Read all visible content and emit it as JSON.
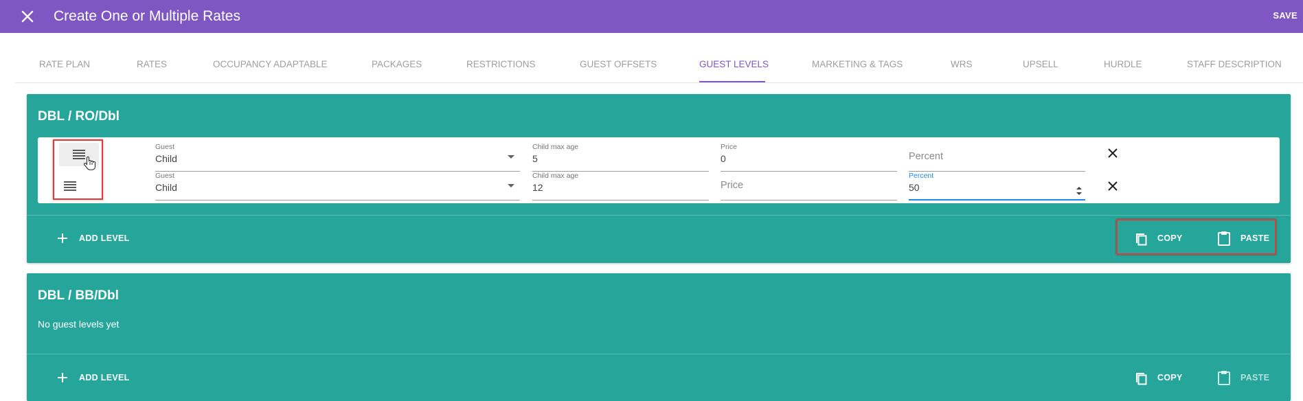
{
  "header": {
    "title": "Create One or Multiple Rates",
    "save_label": "SAVE",
    "close_icon": "close-icon"
  },
  "tabs": [
    {
      "label": "RATE PLAN"
    },
    {
      "label": "RATES"
    },
    {
      "label": "OCCUPANCY ADAPTABLE"
    },
    {
      "label": "PACKAGES"
    },
    {
      "label": "RESTRICTIONS"
    },
    {
      "label": "GUEST OFFSETS"
    },
    {
      "label": "GUEST LEVELS",
      "active": true
    },
    {
      "label": "MARKETING & TAGS"
    },
    {
      "label": "WRS"
    },
    {
      "label": "UPSELL"
    },
    {
      "label": "HURDLE"
    },
    {
      "label": "STAFF DESCRIPTION"
    }
  ],
  "colors": {
    "header": "#7e57c2",
    "card": "#26a69a",
    "focus": "#1e88e5",
    "highlight": "#e53935"
  },
  "cards": [
    {
      "title": "DBL / RO/Dbl",
      "levels": [
        {
          "guest": {
            "label": "Guest",
            "value": "Child"
          },
          "child_max_age": {
            "label": "Child max age",
            "value": "5"
          },
          "price": {
            "label": "Price",
            "value": "0"
          },
          "percent": {
            "placeholder": "Percent"
          }
        },
        {
          "guest": {
            "label": "Guest",
            "value": "Child"
          },
          "child_max_age": {
            "label": "Child max age",
            "value": "12"
          },
          "price": {
            "placeholder": "Price"
          },
          "percent": {
            "label": "Percent",
            "value": "50"
          }
        }
      ],
      "add_label": "ADD LEVEL",
      "copy_label": "COPY",
      "paste_label": "PASTE"
    },
    {
      "title": "DBL / BB/Dbl",
      "empty_text": "No guest levels yet",
      "add_label": "ADD LEVEL",
      "copy_label": "COPY",
      "paste_label": "PASTE"
    }
  ]
}
